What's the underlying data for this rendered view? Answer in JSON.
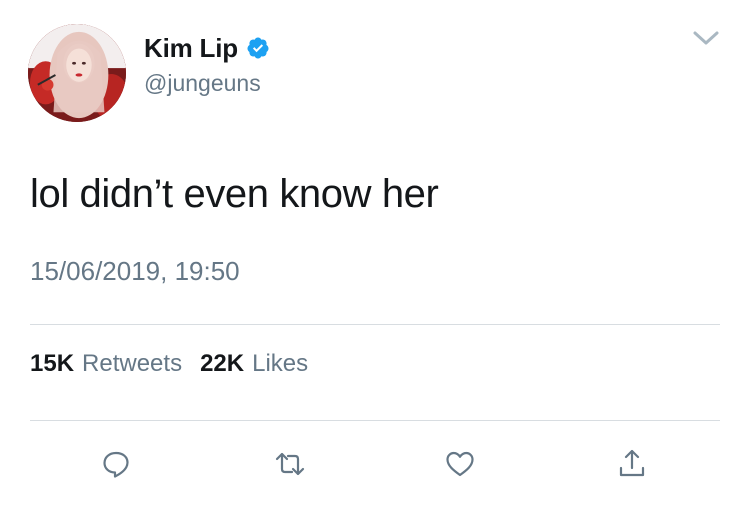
{
  "user": {
    "display_name": "Kim Lip",
    "handle": "@jungeuns",
    "verified": true
  },
  "tweet": {
    "text": "lol didn’t even know her",
    "timestamp": "15/06/2019, 19:50"
  },
  "stats": {
    "retweets_count": "15K",
    "retweets_label": "Retweets",
    "likes_count": "22K",
    "likes_label": "Likes"
  },
  "actions": {
    "reply_icon": "speech-bubble-icon",
    "retweet_icon": "retweet-arrows-icon",
    "like_icon": "heart-icon",
    "share_icon": "share-upload-icon"
  },
  "colors": {
    "text_primary": "#14171a",
    "text_secondary": "#657786",
    "verified_blue": "#1da1f2",
    "divider": "#d8dde1",
    "icon_gray": "#657786"
  }
}
